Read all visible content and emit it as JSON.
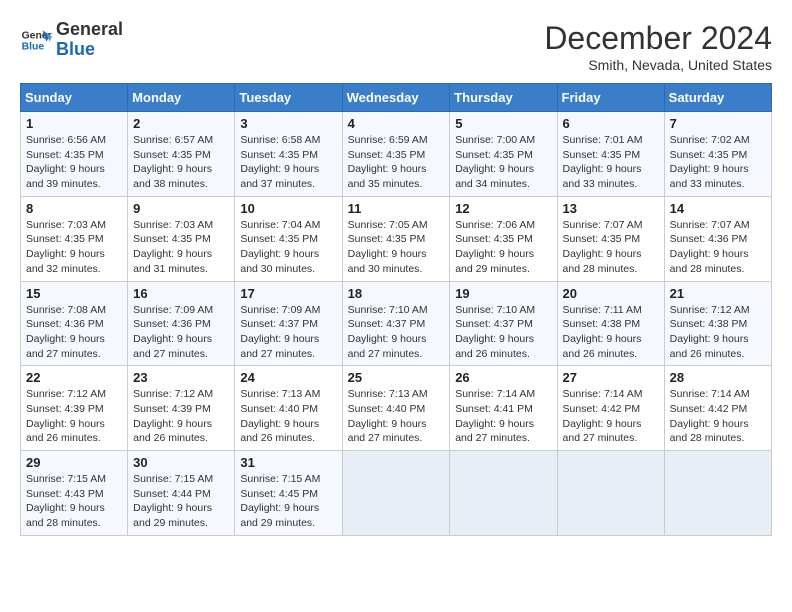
{
  "header": {
    "logo_line1": "General",
    "logo_line2": "Blue",
    "month": "December 2024",
    "location": "Smith, Nevada, United States"
  },
  "days_of_week": [
    "Sunday",
    "Monday",
    "Tuesday",
    "Wednesday",
    "Thursday",
    "Friday",
    "Saturday"
  ],
  "weeks": [
    [
      {
        "num": "1",
        "sunrise": "6:56 AM",
        "sunset": "4:35 PM",
        "daylight": "9 hours and 39 minutes."
      },
      {
        "num": "2",
        "sunrise": "6:57 AM",
        "sunset": "4:35 PM",
        "daylight": "9 hours and 38 minutes."
      },
      {
        "num": "3",
        "sunrise": "6:58 AM",
        "sunset": "4:35 PM",
        "daylight": "9 hours and 37 minutes."
      },
      {
        "num": "4",
        "sunrise": "6:59 AM",
        "sunset": "4:35 PM",
        "daylight": "9 hours and 35 minutes."
      },
      {
        "num": "5",
        "sunrise": "7:00 AM",
        "sunset": "4:35 PM",
        "daylight": "9 hours and 34 minutes."
      },
      {
        "num": "6",
        "sunrise": "7:01 AM",
        "sunset": "4:35 PM",
        "daylight": "9 hours and 33 minutes."
      },
      {
        "num": "7",
        "sunrise": "7:02 AM",
        "sunset": "4:35 PM",
        "daylight": "9 hours and 33 minutes."
      }
    ],
    [
      {
        "num": "8",
        "sunrise": "7:03 AM",
        "sunset": "4:35 PM",
        "daylight": "9 hours and 32 minutes."
      },
      {
        "num": "9",
        "sunrise": "7:03 AM",
        "sunset": "4:35 PM",
        "daylight": "9 hours and 31 minutes."
      },
      {
        "num": "10",
        "sunrise": "7:04 AM",
        "sunset": "4:35 PM",
        "daylight": "9 hours and 30 minutes."
      },
      {
        "num": "11",
        "sunrise": "7:05 AM",
        "sunset": "4:35 PM",
        "daylight": "9 hours and 30 minutes."
      },
      {
        "num": "12",
        "sunrise": "7:06 AM",
        "sunset": "4:35 PM",
        "daylight": "9 hours and 29 minutes."
      },
      {
        "num": "13",
        "sunrise": "7:07 AM",
        "sunset": "4:35 PM",
        "daylight": "9 hours and 28 minutes."
      },
      {
        "num": "14",
        "sunrise": "7:07 AM",
        "sunset": "4:36 PM",
        "daylight": "9 hours and 28 minutes."
      }
    ],
    [
      {
        "num": "15",
        "sunrise": "7:08 AM",
        "sunset": "4:36 PM",
        "daylight": "9 hours and 27 minutes."
      },
      {
        "num": "16",
        "sunrise": "7:09 AM",
        "sunset": "4:36 PM",
        "daylight": "9 hours and 27 minutes."
      },
      {
        "num": "17",
        "sunrise": "7:09 AM",
        "sunset": "4:37 PM",
        "daylight": "9 hours and 27 minutes."
      },
      {
        "num": "18",
        "sunrise": "7:10 AM",
        "sunset": "4:37 PM",
        "daylight": "9 hours and 27 minutes."
      },
      {
        "num": "19",
        "sunrise": "7:10 AM",
        "sunset": "4:37 PM",
        "daylight": "9 hours and 26 minutes."
      },
      {
        "num": "20",
        "sunrise": "7:11 AM",
        "sunset": "4:38 PM",
        "daylight": "9 hours and 26 minutes."
      },
      {
        "num": "21",
        "sunrise": "7:12 AM",
        "sunset": "4:38 PM",
        "daylight": "9 hours and 26 minutes."
      }
    ],
    [
      {
        "num": "22",
        "sunrise": "7:12 AM",
        "sunset": "4:39 PM",
        "daylight": "9 hours and 26 minutes."
      },
      {
        "num": "23",
        "sunrise": "7:12 AM",
        "sunset": "4:39 PM",
        "daylight": "9 hours and 26 minutes."
      },
      {
        "num": "24",
        "sunrise": "7:13 AM",
        "sunset": "4:40 PM",
        "daylight": "9 hours and 26 minutes."
      },
      {
        "num": "25",
        "sunrise": "7:13 AM",
        "sunset": "4:40 PM",
        "daylight": "9 hours and 27 minutes."
      },
      {
        "num": "26",
        "sunrise": "7:14 AM",
        "sunset": "4:41 PM",
        "daylight": "9 hours and 27 minutes."
      },
      {
        "num": "27",
        "sunrise": "7:14 AM",
        "sunset": "4:42 PM",
        "daylight": "9 hours and 27 minutes."
      },
      {
        "num": "28",
        "sunrise": "7:14 AM",
        "sunset": "4:42 PM",
        "daylight": "9 hours and 28 minutes."
      }
    ],
    [
      {
        "num": "29",
        "sunrise": "7:15 AM",
        "sunset": "4:43 PM",
        "daylight": "9 hours and 28 minutes."
      },
      {
        "num": "30",
        "sunrise": "7:15 AM",
        "sunset": "4:44 PM",
        "daylight": "9 hours and 29 minutes."
      },
      {
        "num": "31",
        "sunrise": "7:15 AM",
        "sunset": "4:45 PM",
        "daylight": "9 hours and 29 minutes."
      },
      null,
      null,
      null,
      null
    ]
  ]
}
